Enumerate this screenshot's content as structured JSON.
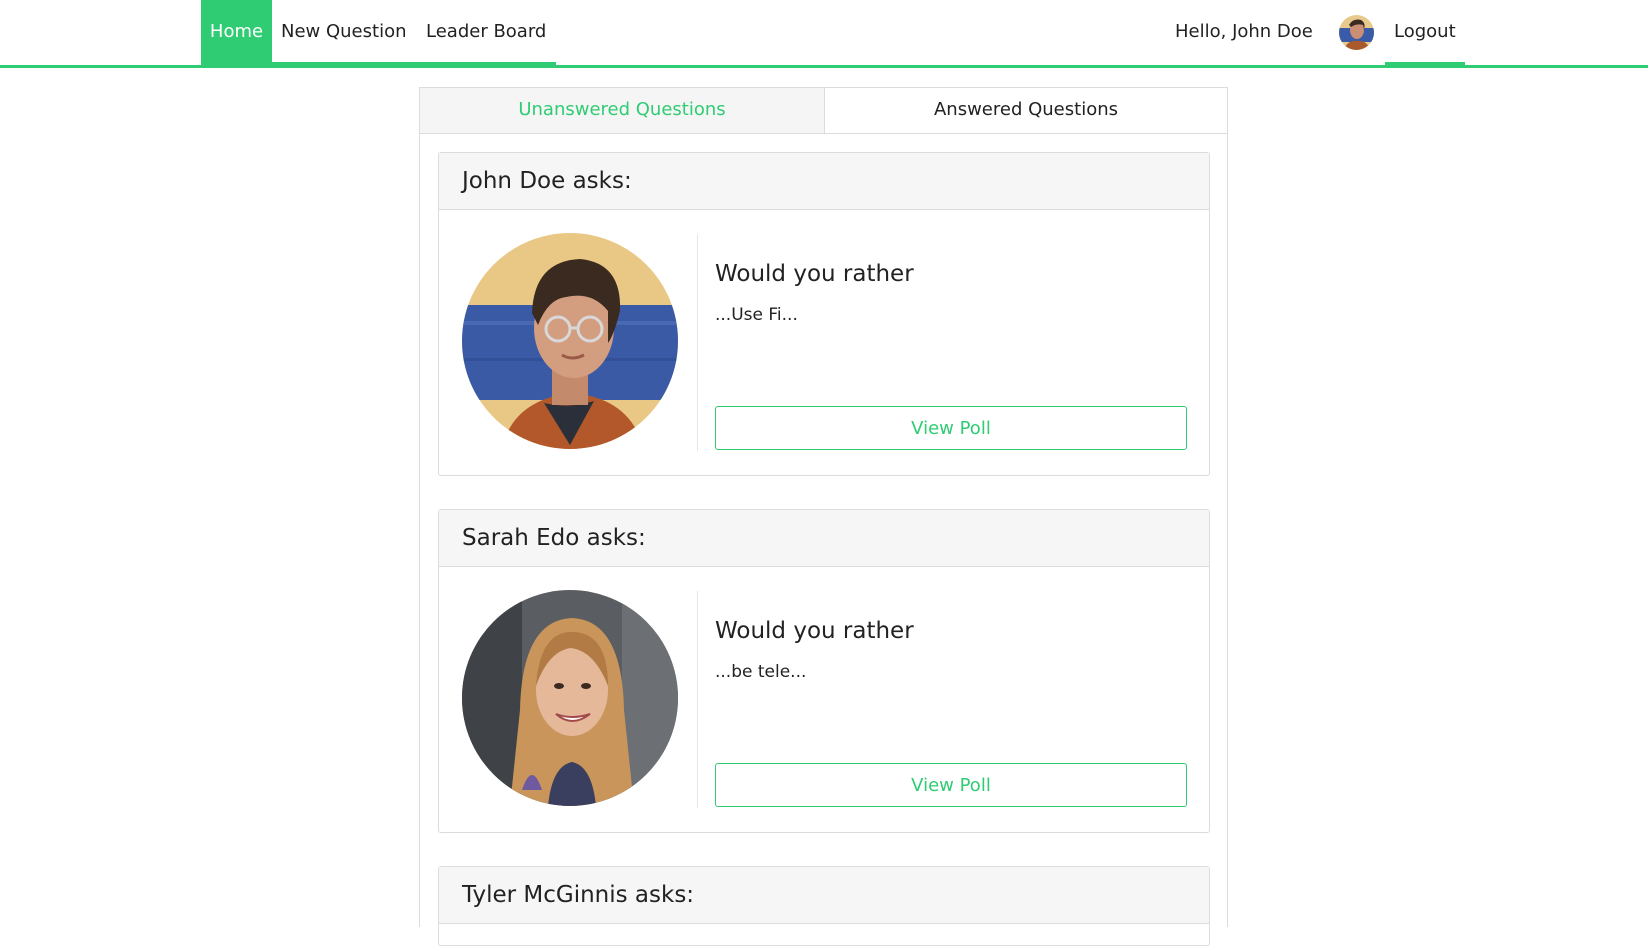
{
  "nav": {
    "home": "Home",
    "new_question": "New Question",
    "leader_board": "Leader Board",
    "greeting": "Hello, John Doe",
    "logout": "Logout"
  },
  "tabs": {
    "unanswered": "Unanswered Questions",
    "answered": "Answered Questions"
  },
  "questions": [
    {
      "header": "John Doe asks:",
      "prompt": "Would you rather",
      "snippet": "...Use Fi...",
      "button": "View Poll"
    },
    {
      "header": "Sarah Edo asks:",
      "prompt": "Would you rather",
      "snippet": "...be tele...",
      "button": "View Poll"
    },
    {
      "header": "Tyler McGinnis asks:"
    }
  ],
  "colors": {
    "accent": "#2fcc73",
    "header_bg": "#f6f6f6",
    "border": "#dcdcdc"
  },
  "icons": {
    "user_avatar": "user-avatar-icon"
  }
}
